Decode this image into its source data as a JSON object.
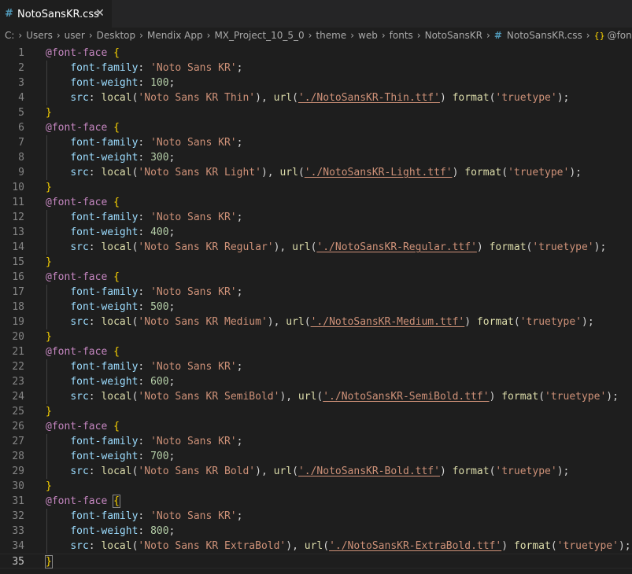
{
  "tab": {
    "icon": "#",
    "label": "NotoSansKR.css",
    "close": "✕"
  },
  "breadcrumb": {
    "items": [
      "C:",
      "Users",
      "user",
      "Desktop",
      "Mendix App",
      "MX_Project_10_5_0",
      "theme",
      "web",
      "fonts",
      "NotoSansKR"
    ],
    "file_icon": "#",
    "file": "NotoSansKR.css",
    "symbol_icon": "{}",
    "symbol": "@font"
  },
  "editor": {
    "current_line": 35,
    "blocks": [
      {
        "weight": "100",
        "local": "Noto Sans KR Thin",
        "url": "./NotoSansKR-Thin.ttf"
      },
      {
        "weight": "300",
        "local": "Noto Sans KR Light",
        "url": "./NotoSansKR-Light.ttf"
      },
      {
        "weight": "400",
        "local": "Noto Sans KR Regular",
        "url": "./NotoSansKR-Regular.ttf"
      },
      {
        "weight": "500",
        "local": "Noto Sans KR Medium",
        "url": "./NotoSansKR-Medium.ttf"
      },
      {
        "weight": "600",
        "local": "Noto Sans KR SemiBold",
        "url": "./NotoSansKR-SemiBold.ttf"
      },
      {
        "weight": "700",
        "local": "Noto Sans KR Bold",
        "url": "./NotoSansKR-Bold.ttf"
      },
      {
        "weight": "800",
        "local": "Noto Sans KR ExtraBold",
        "url": "./NotoSansKR-ExtraBold.ttf"
      }
    ],
    "family": "Noto Sans KR",
    "format": "truetype"
  },
  "colors": {
    "background": "#1e1e1e",
    "keyword": "#c586c0",
    "brace": "#ffd700",
    "property": "#9cdcfe",
    "number": "#b5cea8",
    "string": "#ce9178",
    "function": "#dcdcaa",
    "css_icon": "#519aba"
  }
}
